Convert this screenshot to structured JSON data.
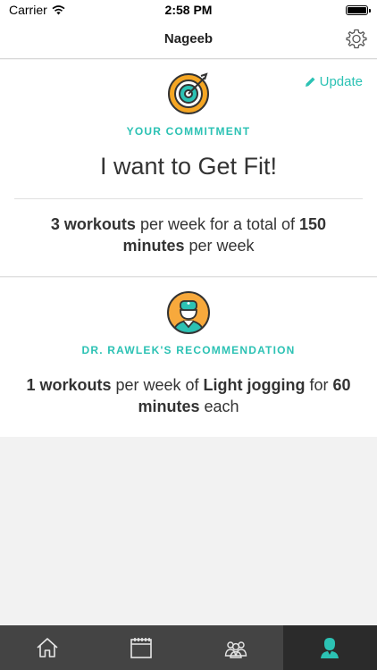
{
  "status_bar": {
    "carrier": "Carrier",
    "time": "2:58 PM"
  },
  "nav": {
    "title": "Nageeb",
    "settings_icon": "gear-icon"
  },
  "commitment": {
    "update_label": "Update",
    "update_icon": "pencil-icon",
    "icon": "target-icon",
    "section_label": "YOUR COMMITMENT",
    "goal": "I want to Get Fit!",
    "workouts": "3 workouts",
    "text_1": " per week for a total of ",
    "minutes": "150 minutes",
    "text_2": " per week"
  },
  "recommendation": {
    "icon": "doctor-avatar-icon",
    "section_label": "DR. RAWLEK'S RECOMMENDATION",
    "workouts": "1 workouts",
    "text_1": " per week of ",
    "activity": "Light jogging",
    "text_2": " for ",
    "minutes": "60 minutes",
    "text_3": " each"
  },
  "tab_bar": {
    "tabs": [
      {
        "icon": "home-icon",
        "active": false
      },
      {
        "icon": "calendar-icon",
        "active": false
      },
      {
        "icon": "group-icon",
        "active": false
      },
      {
        "icon": "profile-icon",
        "active": true
      }
    ]
  },
  "colors": {
    "accent": "#2cc2b4",
    "tab_bar_bg": "#444444",
    "tab_active_bg": "#2b2b2b",
    "target_orange": "#f5a623",
    "avatar_orange": "#f7a93c"
  }
}
